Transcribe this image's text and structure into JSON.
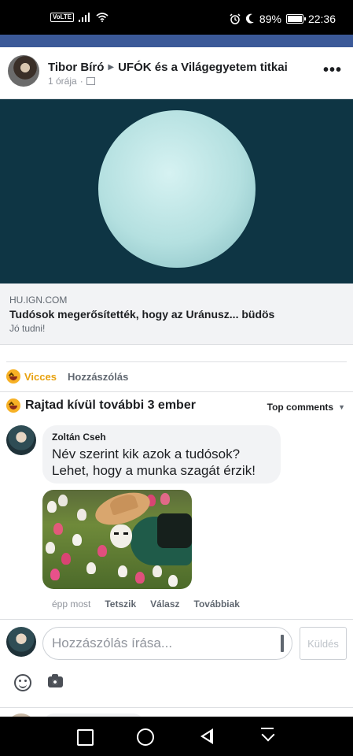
{
  "status_bar": {
    "volte": "VoLTE",
    "battery_percent": "89%",
    "battery_level": 0.89,
    "time": "22:36"
  },
  "post": {
    "author": "Tibor Bíró",
    "target_group": "UFÓK és a Világegyetem titkai",
    "time_ago": "1 órája",
    "meta_separator": "·",
    "link": {
      "domain": "HU.IGN.COM",
      "title": "Tudósok megerősítették, hogy az Uránusz... büdös",
      "description": "Jó tudni!"
    }
  },
  "actions": {
    "reaction_label": "Vicces",
    "comment_label": "Hozzászólás"
  },
  "reactions_summary": {
    "text": "Rajtad kívül további 3 ember",
    "sort_label": "Top comments"
  },
  "comment": {
    "author": "Zoltán Cseh",
    "text": "Név szerint kik azok a tudósok? Lehet, hogy a munka szagát érzik!",
    "time": "épp most",
    "like_label": "Tetszik",
    "reply_label": "Válasz",
    "more_label": "Továbbiak"
  },
  "composer": {
    "placeholder": "Hozzászólás írása...",
    "send_label": "Küldés"
  },
  "icons": {
    "more": "more-dots-icon",
    "haha": "haha-reaction-icon",
    "emoji": "emoji-icon",
    "camera": "camera-icon",
    "wifi": "wifi-icon",
    "signal": "signal-icon",
    "alarm": "alarm-icon",
    "moon": "moon-icon"
  },
  "colors": {
    "facebook_blue": "#3b5998",
    "haha_yellow": "#f7b125",
    "reaction_text": "#e8a20f",
    "bubble_bg": "#f2f3f5",
    "image_bg": "#0e3544"
  }
}
